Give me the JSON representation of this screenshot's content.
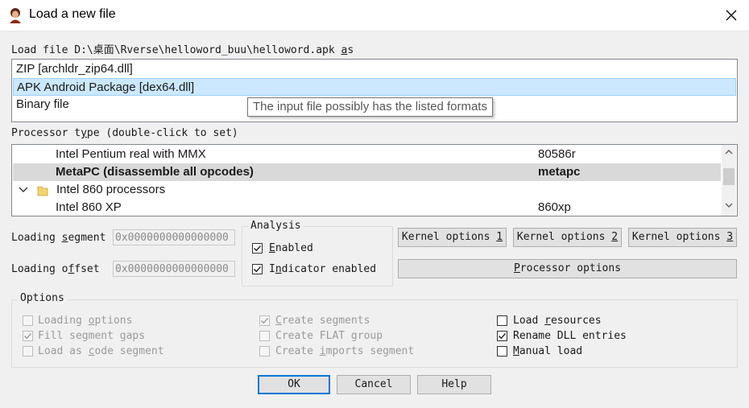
{
  "window": {
    "title": "Load a new file",
    "close_glyph": "✕"
  },
  "load_file": {
    "label_prefix": "Load file ",
    "path": "D:\\桌面\\Rverse\\helloword_buu\\helloword.apk",
    "label_suffix": " as",
    "formats": [
      "ZIP [archldr_zip64.dll]",
      "APK Android Package [dex64.dll]",
      "Binary file"
    ],
    "selected_index": 1,
    "tooltip": "The input file possibly has the listed formats"
  },
  "processor": {
    "label": "Processor type (double-click to set)",
    "rows": [
      {
        "name": "Intel Pentium real with MMX",
        "code": "80586r",
        "indent": 1
      },
      {
        "name": "MetaPC (disassemble all opcodes)",
        "code": "metapc",
        "indent": 1,
        "highlighted": true
      },
      {
        "name": "Intel 860 processors",
        "code": "",
        "indent": 0,
        "folder": true,
        "expanded": true
      },
      {
        "name": "Intel 860 XP",
        "code": "860xp",
        "indent": 1
      }
    ]
  },
  "loading_segment": {
    "label": "Loading segment",
    "value": "0x0000000000000000"
  },
  "loading_offset": {
    "label": "Loading offset",
    "value": "0x0000000000000000"
  },
  "analysis": {
    "title": "Analysis",
    "enabled": {
      "label": "Enabled",
      "checked": true
    },
    "indicator": {
      "label": "Indicator enabled",
      "checked": true
    }
  },
  "buttons": {
    "kernel1": "Kernel options 1",
    "kernel2": "Kernel options 2",
    "kernel3": "Kernel options 3",
    "processor_options": "Processor options",
    "ok": "OK",
    "cancel": "Cancel",
    "help": "Help"
  },
  "options": {
    "title": "Options",
    "items": [
      {
        "label": "Loading options",
        "checked": false,
        "disabled": true
      },
      {
        "label": "Fill segment gaps",
        "checked": true,
        "disabled": true
      },
      {
        "label": "Load as code segment",
        "checked": false,
        "disabled": true
      },
      {
        "label": "Create segments",
        "checked": true,
        "disabled": true
      },
      {
        "label": "Create FLAT group",
        "checked": false,
        "disabled": true
      },
      {
        "label": "Create imports segment",
        "checked": false,
        "disabled": true
      },
      {
        "label": "Load resources",
        "checked": false,
        "disabled": false
      },
      {
        "label": "Rename DLL entries",
        "checked": true,
        "disabled": false
      },
      {
        "label": "Manual load",
        "checked": false,
        "disabled": false
      }
    ]
  }
}
